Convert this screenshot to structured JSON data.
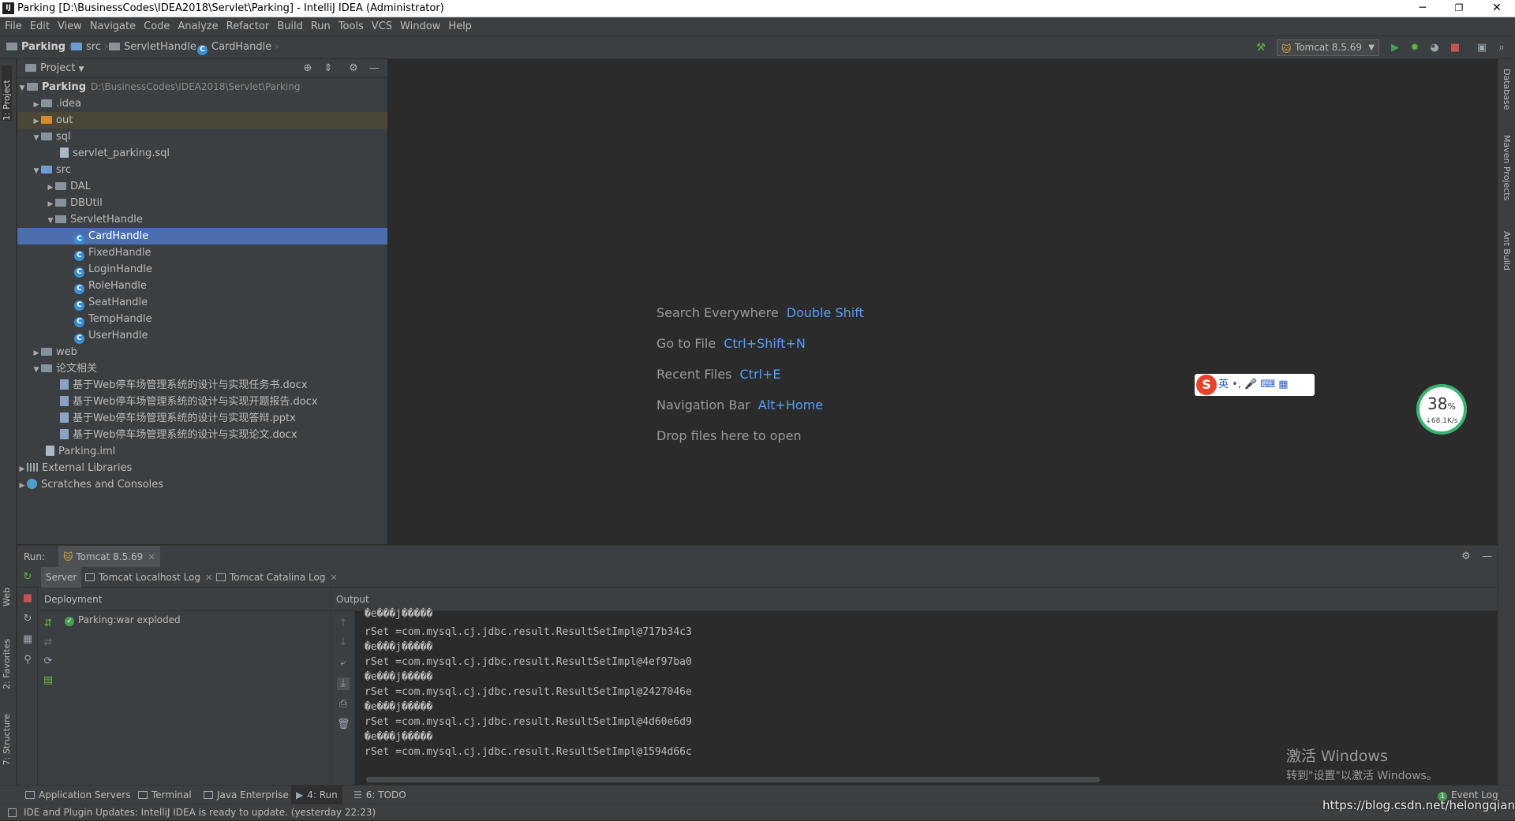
{
  "window": {
    "title": "Parking [D:\\BusinessCodes\\IDEA2018\\Servlet\\Parking] - IntelliJ IDEA (Administrator)",
    "icon": "IJ",
    "minimize": "─",
    "maximize": "❐",
    "close": "✕"
  },
  "menu": [
    "File",
    "Edit",
    "View",
    "Navigate",
    "Code",
    "Analyze",
    "Refactor",
    "Build",
    "Run",
    "Tools",
    "VCS",
    "Window",
    "Help"
  ],
  "breadcrumb": {
    "project": "Parking",
    "src": "src",
    "pkg": "ServletHandle",
    "cls": "CardHandle"
  },
  "toolbar": {
    "run_config": "Tomcat 8.5.69"
  },
  "project_panel": {
    "title": "Project",
    "root_name": "Parking",
    "root_path": "D:\\BusinessCodes\\IDEA2018\\Servlet\\Parking",
    "tree": {
      "idea": ".idea",
      "out": "out",
      "sql": "sql",
      "sql_file": "servlet_parking.sql",
      "src": "src",
      "dal": "DAL",
      "dbutil": "DBUtil",
      "servlethandle": "ServletHandle",
      "classes": [
        "CardHandle",
        "FixedHandle",
        "LoginHandle",
        "RoleHandle",
        "SeatHandle",
        "TempHandle",
        "UserHandle"
      ],
      "web": "web",
      "thesis": "论文相关",
      "docs": [
        "基于Web停车场管理系统的设计与实现任务书.docx",
        "基于Web停车场管理系统的设计与实现开题报告.docx",
        "基于Web停车场管理系统的设计与实现答辩.pptx",
        "基于Web停车场管理系统的设计与实现论文.docx"
      ],
      "iml": "Parking.iml",
      "ext_libs": "External Libraries",
      "scratches": "Scratches and Consoles"
    }
  },
  "editor_hints": [
    {
      "label": "Search Everywhere",
      "key": "Double Shift"
    },
    {
      "label": "Go to File",
      "key": "Ctrl+Shift+N"
    },
    {
      "label": "Recent Files",
      "key": "Ctrl+E"
    },
    {
      "label": "Navigation Bar",
      "key": "Alt+Home"
    },
    {
      "label": "Drop files here to open",
      "key": ""
    }
  ],
  "ime": {
    "logo": "S",
    "text": "英 •, 🎤 ⌨ ▦"
  },
  "speed": {
    "percent": "38",
    "unit": "%",
    "rate": "↓68.1K/s"
  },
  "left_tabs": {
    "project": "1: Project",
    "web": "Web",
    "favorites": "2: Favorites",
    "structure": "7: Structure"
  },
  "right_tabs": {
    "database": "Database",
    "maven": "Maven Projects",
    "ant": "Ant Build"
  },
  "run_panel": {
    "label": "Run:",
    "config": "Tomcat 8.5.69",
    "tabs": [
      "Server",
      "Tomcat Localhost Log",
      "Tomcat Catalina Log"
    ],
    "deployment_header": "Deployment",
    "output_header": "Output",
    "deployment_item": "Parking:war exploded",
    "console": [
      "�e���j�����",
      "rSet =com.mysql.cj.jdbc.result.ResultSetImpl@717b34c3",
      "�e���j�����",
      "rSet =com.mysql.cj.jdbc.result.ResultSetImpl@4ef97ba0",
      "�e���j�����",
      "rSet =com.mysql.cj.jdbc.result.ResultSetImpl@2427046e",
      "�e���j�����",
      "rSet =com.mysql.cj.jdbc.result.ResultSetImpl@4d60e6d9",
      "�e���j�����",
      "rSet =com.mysql.cj.jdbc.result.ResultSetImpl@1594d66c"
    ]
  },
  "watermark": {
    "line1": "激活 Windows",
    "line2": "转到\"设置\"以激活 Windows。"
  },
  "bottom_tabs": [
    "Application Servers",
    "Terminal",
    "Java Enterprise",
    "4: Run",
    "6: TODO"
  ],
  "event_log": {
    "count": "1",
    "label": "Event Log"
  },
  "status": "IDE and Plugin Updates: IntelliJ IDEA is ready to update. (yesterday 22:23)",
  "csdn": "https://blog.csdn.net/helongqiang"
}
